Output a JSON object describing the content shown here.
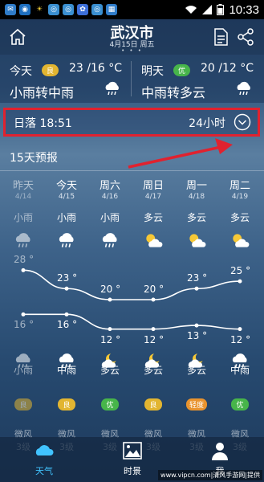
{
  "status_bar": {
    "time": "10:33"
  },
  "header": {
    "city": "武汉市",
    "date": "4月15日 周五",
    "page_dots": "• • •"
  },
  "today": {
    "label": "今天",
    "aqi": "良",
    "temps": "23 /16 °C",
    "desc": "小雨转中雨",
    "icon": "rain-cloud-icon"
  },
  "tomorrow": {
    "label": "明天",
    "aqi": "优",
    "temps": "20 /12 °C",
    "desc": "中雨转多云",
    "icon": "rain-cloud-icon"
  },
  "sunset": {
    "text": "日落 18:51",
    "hours": "24小时"
  },
  "forecast": {
    "title": "15天预报",
    "days": [
      {
        "name": "昨天",
        "date": "4/14",
        "day": "小雨",
        "night": "小雨",
        "high": "28 °",
        "low": "16 °",
        "aqi": "良",
        "aqi_color": "#e2b531",
        "past": true,
        "icon_day": "rain",
        "icon_night": "rain"
      },
      {
        "name": "今天",
        "date": "4/15",
        "day": "小雨",
        "night": "中雨",
        "high": "23 °",
        "low": "16 °",
        "aqi": "良",
        "aqi_color": "#e2b531",
        "past": false,
        "icon_day": "rain",
        "icon_night": "rain"
      },
      {
        "name": "周六",
        "date": "4/16",
        "day": "小雨",
        "night": "多云",
        "high": "20 °",
        "low": "12 °",
        "aqi": "优",
        "aqi_color": "#47b54a",
        "past": false,
        "icon_day": "rain",
        "icon_night": "moon-cloud"
      },
      {
        "name": "周日",
        "date": "4/17",
        "day": "多云",
        "night": "多云",
        "high": "20 °",
        "low": "12 °",
        "aqi": "良",
        "aqi_color": "#e2b531",
        "past": false,
        "icon_day": "sun-cloud",
        "icon_night": "moon-cloud"
      },
      {
        "name": "周一",
        "date": "4/18",
        "day": "多云",
        "night": "多云",
        "high": "23 °",
        "low": "13 °",
        "aqi": "轻度",
        "aqi_color": "#e8932e",
        "past": false,
        "icon_day": "sun-cloud",
        "icon_night": "moon-cloud"
      },
      {
        "name": "周二",
        "date": "4/19",
        "day": "多云",
        "night": "中雨",
        "high": "25 °",
        "low": "12 °",
        "aqi": "优",
        "aqi_color": "#47b54a",
        "past": false,
        "icon_day": "sun-cloud",
        "icon_night": "rain"
      }
    ],
    "wind": [
      {
        "dir": "微风",
        "level": "3级"
      },
      {
        "dir": "微风",
        "level": "3级"
      },
      {
        "dir": "微风",
        "level": "3级"
      },
      {
        "dir": "微风",
        "level": "3级"
      },
      {
        "dir": "微风",
        "level": "3级"
      },
      {
        "dir": "微风",
        "level": "3级"
      }
    ]
  },
  "chart_data": {
    "type": "line",
    "categories": [
      "4/14",
      "4/15",
      "4/16",
      "4/17",
      "4/18",
      "4/19"
    ],
    "series": [
      {
        "values": [
          28,
          23,
          20,
          20,
          23,
          25
        ]
      },
      {
        "values": [
          16,
          16,
          12,
          12,
          13,
          12
        ]
      }
    ]
  },
  "nav": [
    {
      "label": "天气",
      "icon": "cloud-icon",
      "active": true
    },
    {
      "label": "时景",
      "icon": "photo-icon",
      "active": false
    },
    {
      "label": "我",
      "icon": "person-icon",
      "active": false
    }
  ],
  "watermark": "www.vipcn.com|清风手游网|提供",
  "colors": {
    "aqi_good": "#e2b531",
    "aqi_excellent": "#47b54a",
    "highlight": "#e0222f",
    "accent": "#41c3ff"
  }
}
